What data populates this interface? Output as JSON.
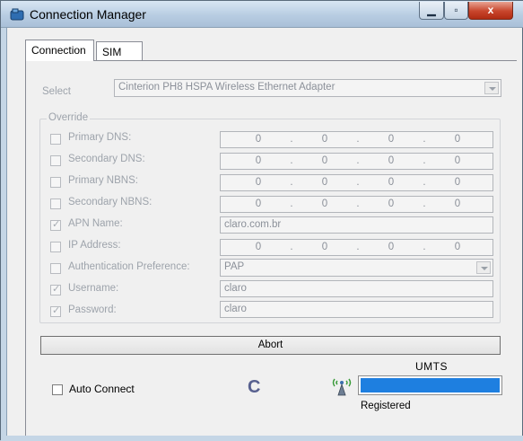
{
  "window": {
    "title": "Connection Manager",
    "close_glyph": "x"
  },
  "tabs": [
    {
      "label": "Connection",
      "active": true
    },
    {
      "label": "SIM",
      "active": false
    }
  ],
  "select": {
    "label": "Select",
    "value": "Cinterion PH8 HSPA Wireless Ethernet Adapter"
  },
  "override": {
    "legend": "Override",
    "rows": [
      {
        "label": "Primary DNS:",
        "checked": false,
        "octets": [
          "0",
          "0",
          "0",
          "0"
        ]
      },
      {
        "label": "Secondary DNS:",
        "checked": false,
        "octets": [
          "0",
          "0",
          "0",
          "0"
        ]
      },
      {
        "label": "Primary NBNS:",
        "checked": false,
        "octets": [
          "0",
          "0",
          "0",
          "0"
        ]
      },
      {
        "label": "Secondary NBNS:",
        "checked": false,
        "octets": [
          "0",
          "0",
          "0",
          "0"
        ]
      },
      {
        "label": "APN Name:",
        "checked": true,
        "value": "claro.com.br"
      },
      {
        "label": "IP Address:",
        "checked": false,
        "octets": [
          "0",
          "0",
          "0",
          "0"
        ]
      },
      {
        "label": "Authentication Preference:",
        "checked": false,
        "value": "PAP"
      },
      {
        "label": "Username:",
        "checked": true,
        "value": "claro"
      },
      {
        "label": "Password:",
        "checked": true,
        "value": "claro"
      }
    ]
  },
  "abort_label": "Abort",
  "auto_connect": {
    "label": "Auto Connect",
    "checked": false
  },
  "spinner_glyph": "C",
  "status": {
    "network": "UMTS",
    "registration": "Registered",
    "signal_level": 1.0,
    "signal_color": "#1e7fe0"
  },
  "colors": {
    "accent": "#1e7fe0",
    "disabled_text": "#9da3ab"
  },
  "icons": {
    "app": "connection-manager-icon",
    "signal": "antenna-icon"
  }
}
